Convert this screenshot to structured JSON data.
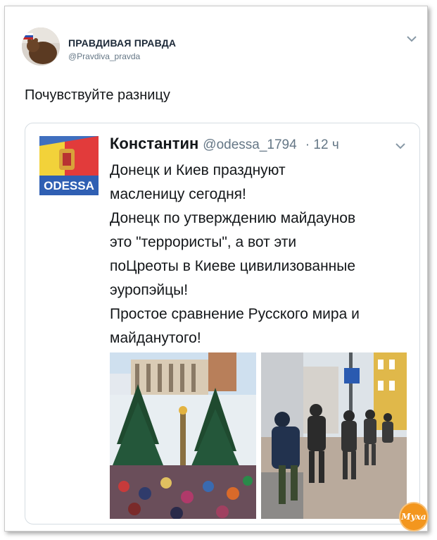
{
  "header": {
    "display_name": "ПРАВДИВАЯ ПРАВДА",
    "handle": "@Pravdiva_pravda"
  },
  "tweet": {
    "text": "Почувствуйте разницу"
  },
  "quoted": {
    "name": "Константин",
    "handle": "@odessa_1794",
    "time": "· 12 ч",
    "avatar_text": "ODESSA",
    "lines": [
      "Донецк и Киев празднуют",
      "масленицу сегодня!",
      "Донецк по утверждению майдаунов",
      "это \"террористы\", а вот эти",
      "поЦреоты в Киеве цивилизованные",
      "эуропэйцы!",
      "Простое сравнение Русского мира и",
      "майданутого!"
    ]
  },
  "watermark": {
    "text": "Муха"
  },
  "colors": {
    "accent_text": "#14171a",
    "secondary_text": "#657786",
    "border": "#d6dde3",
    "watermark": "#f3961e"
  },
  "icons": [
    "chevron-down-icon",
    "chevron-down-icon"
  ]
}
